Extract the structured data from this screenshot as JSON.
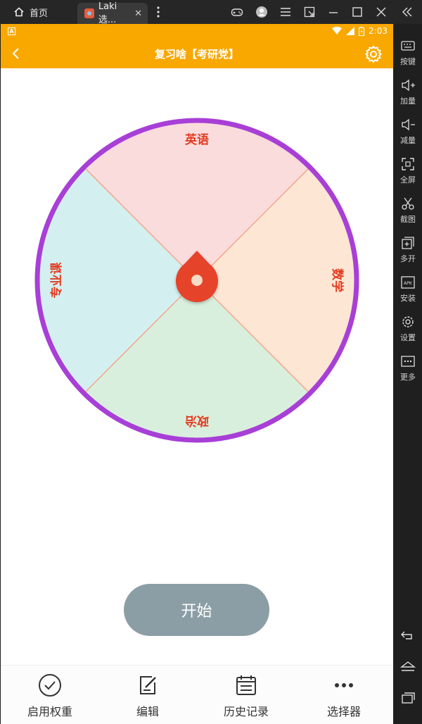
{
  "emulator": {
    "home_tab_label": "首页",
    "app_tab_label": "Laki选...",
    "sidebar": [
      {
        "label": "按键",
        "icon": "keyboard-icon"
      },
      {
        "label": "加量",
        "icon": "volume-up-icon"
      },
      {
        "label": "减量",
        "icon": "volume-down-icon"
      },
      {
        "label": "全屏",
        "icon": "fullscreen-icon"
      },
      {
        "label": "截图",
        "icon": "scissors-icon"
      },
      {
        "label": "多开",
        "icon": "multi-window-icon"
      },
      {
        "label": "安装",
        "icon": "apk-icon"
      },
      {
        "label": "设置",
        "icon": "gear-icon"
      },
      {
        "label": "更多",
        "icon": "more-icon"
      }
    ]
  },
  "statusbar": {
    "time": "2:03"
  },
  "appbar": {
    "title": "复习啥【考研党】"
  },
  "wheel": {
    "segments": [
      {
        "label": "英语",
        "color": "#fbdcdc"
      },
      {
        "label": "数学",
        "color": "#fde6d4"
      },
      {
        "label": "政治",
        "color": "#d9efdd"
      },
      {
        "label": "专业课",
        "color": "#d4eff0"
      }
    ],
    "rim_color": "#a83fd6",
    "divider_color": "#f3a58a",
    "label_color": "#e33b1f",
    "pointer_color": "#e5432a"
  },
  "start_button": {
    "label": "开始"
  },
  "bottom_nav": [
    {
      "label": "启用权重",
      "icon": "check-circle-icon"
    },
    {
      "label": "编辑",
      "icon": "edit-icon"
    },
    {
      "label": "历史记录",
      "icon": "calendar-list-icon"
    },
    {
      "label": "选择器",
      "icon": "more-dots-icon"
    }
  ],
  "colors": {
    "accent": "#f9a800",
    "button_gray": "#8c9ea5"
  }
}
